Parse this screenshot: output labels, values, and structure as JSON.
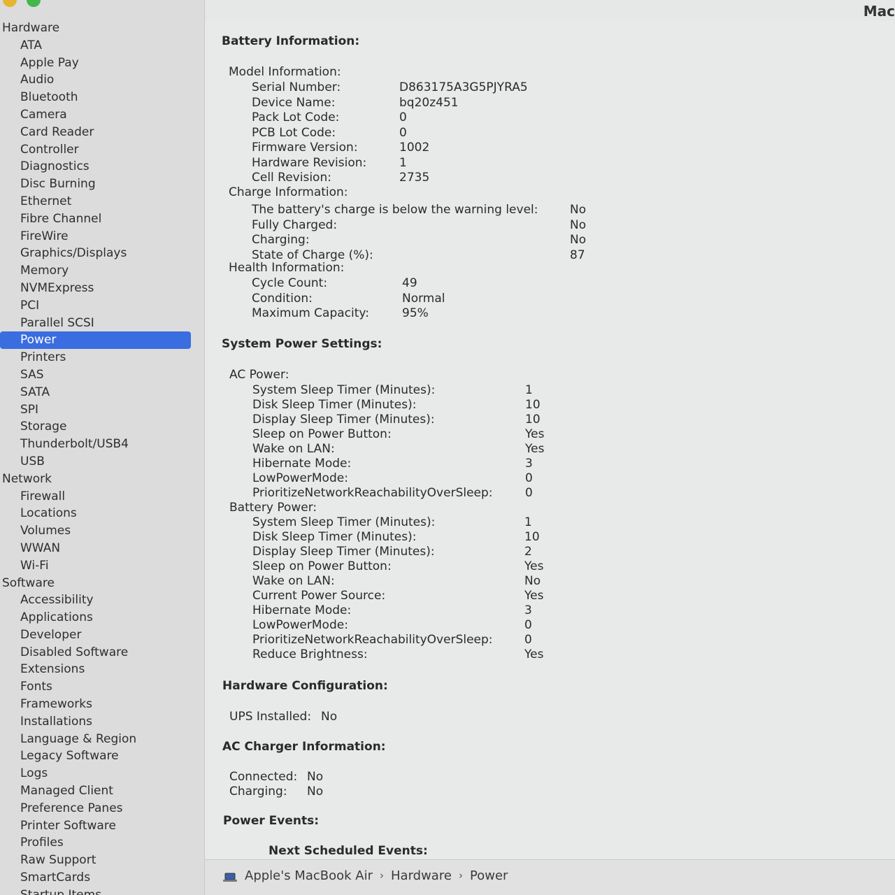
{
  "window": {
    "title_fragment": "Mac"
  },
  "sidebar": {
    "sections": [
      {
        "label": "Hardware",
        "items": [
          "ATA",
          "Apple Pay",
          "Audio",
          "Bluetooth",
          "Camera",
          "Card Reader",
          "Controller",
          "Diagnostics",
          "Disc Burning",
          "Ethernet",
          "Fibre Channel",
          "FireWire",
          "Graphics/Displays",
          "Memory",
          "NVMExpress",
          "PCI",
          "Parallel SCSI",
          "Power",
          "Printers",
          "SAS",
          "SATA",
          "SPI",
          "Storage",
          "Thunderbolt/USB4",
          "USB"
        ]
      },
      {
        "label": "Network",
        "items": [
          "Firewall",
          "Locations",
          "Volumes",
          "WWAN",
          "Wi-Fi"
        ]
      },
      {
        "label": "Software",
        "items": [
          "Accessibility",
          "Applications",
          "Developer",
          "Disabled Software",
          "Extensions",
          "Fonts",
          "Frameworks",
          "Installations",
          "Language & Region",
          "Legacy Software",
          "Logs",
          "Managed Client",
          "Preference Panes",
          "Printer Software",
          "Profiles",
          "Raw Support",
          "SmartCards",
          "Startup Items"
        ]
      }
    ],
    "selected": "Power"
  },
  "battery": {
    "heading": "Battery Information:",
    "model_heading": "Model Information:",
    "model": [
      [
        "Serial Number:",
        "D863175A3G5PJYRA5"
      ],
      [
        "Device Name:",
        "bq20z451"
      ],
      [
        "Pack Lot Code:",
        "0"
      ],
      [
        "PCB Lot Code:",
        "0"
      ],
      [
        "Firmware Version:",
        "1002"
      ],
      [
        "Hardware Revision:",
        "1"
      ],
      [
        "Cell Revision:",
        "2735"
      ]
    ],
    "charge_heading": "Charge Information:",
    "charge": [
      [
        "The battery's charge is below the warning level:",
        "No"
      ],
      [
        "Fully Charged:",
        "No"
      ],
      [
        "Charging:",
        "No"
      ],
      [
        "State of Charge (%):",
        "87"
      ]
    ],
    "health_heading": "Health Information:",
    "health": [
      [
        "Cycle Count:",
        "49"
      ],
      [
        "Condition:",
        "Normal"
      ],
      [
        "Maximum Capacity:",
        "95%"
      ]
    ]
  },
  "power_settings": {
    "heading": "System Power Settings:",
    "ac_heading": "AC Power:",
    "ac": [
      [
        "System Sleep Timer (Minutes):",
        "1"
      ],
      [
        "Disk Sleep Timer (Minutes):",
        "10"
      ],
      [
        "Display Sleep Timer (Minutes):",
        "10"
      ],
      [
        "Sleep on Power Button:",
        "Yes"
      ],
      [
        "Wake on LAN:",
        "Yes"
      ],
      [
        "Hibernate Mode:",
        "3"
      ],
      [
        "LowPowerMode:",
        "0"
      ],
      [
        "PrioritizeNetworkReachabilityOverSleep:",
        "0"
      ]
    ],
    "battery_heading": "Battery Power:",
    "battery": [
      [
        "System Sleep Timer (Minutes):",
        "1"
      ],
      [
        "Disk Sleep Timer (Minutes):",
        "10"
      ],
      [
        "Display Sleep Timer (Minutes):",
        "2"
      ],
      [
        "Sleep on Power Button:",
        "Yes"
      ],
      [
        "Wake on LAN:",
        "No"
      ],
      [
        "Current Power Source:",
        "Yes"
      ],
      [
        "Hibernate Mode:",
        "3"
      ],
      [
        "LowPowerMode:",
        "0"
      ],
      [
        "PrioritizeNetworkReachabilityOverSleep:",
        "0"
      ],
      [
        "Reduce Brightness:",
        "Yes"
      ]
    ]
  },
  "hardware_config": {
    "heading": "Hardware Configuration:",
    "ups_label": "UPS Installed:",
    "ups_value": "No"
  },
  "ac_charger": {
    "heading": "AC Charger Information:",
    "connected_label": "Connected:",
    "connected_value": "No",
    "charging_label": "Charging:",
    "charging_value": "No"
  },
  "power_events": {
    "heading": "Power Events:",
    "next_heading": "Next Scheduled Events:"
  },
  "pathbar": {
    "items": [
      "Apple's MacBook Air",
      "Hardware",
      "Power"
    ],
    "separator": "›"
  }
}
